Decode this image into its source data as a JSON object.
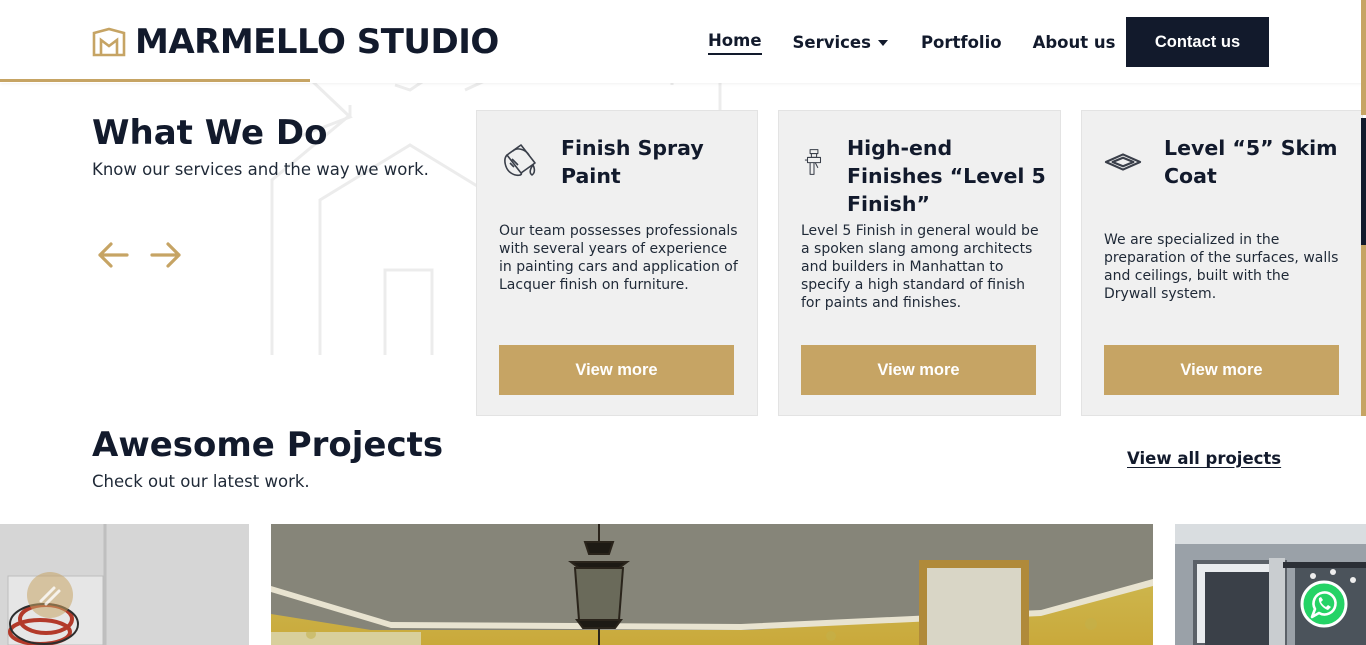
{
  "brand": {
    "name": "MARMELLO STUDIO",
    "accent": "#c6a464",
    "dark": "#121a2c"
  },
  "nav": {
    "items": [
      {
        "label": "Home",
        "active": true
      },
      {
        "label": "Services",
        "dropdown": true
      },
      {
        "label": "Portfolio"
      },
      {
        "label": "About us"
      }
    ],
    "contact_label": "Contact us"
  },
  "services_section": {
    "title": "What We Do",
    "subtitle": "Know our services and the way we work.",
    "prev_icon": "arrow-left-icon",
    "next_icon": "arrow-right-icon",
    "cards": [
      {
        "icon": "paint-bucket-icon",
        "title": "Finish Spray Paint",
        "text": "Our team possesses professionals with several years of experience in painting cars and application of Lacquer finish on furniture.",
        "button": "View more"
      },
      {
        "icon": "spray-gun-icon",
        "title": "High-end Finishes “Level 5 Finish”",
        "text": "Level 5 Finish in general would be a spoken slang among architects and builders in Manhattan to specify a high standard of finish for paints and finishes.",
        "button": "View more"
      },
      {
        "icon": "drywall-panel-icon",
        "title": "Level “5” Skim Coat",
        "text": "We are specialized in the preparation of the surfaces, walls and ceilings, built with the Drywall system.",
        "button": "View more"
      }
    ]
  },
  "projects_section": {
    "title": "Awesome Projects",
    "subtitle": "Check out our latest work.",
    "view_all": "View all projects"
  },
  "floating": {
    "whatsapp_icon": "whatsapp-icon",
    "badge_icon": "round-badge-icon"
  }
}
